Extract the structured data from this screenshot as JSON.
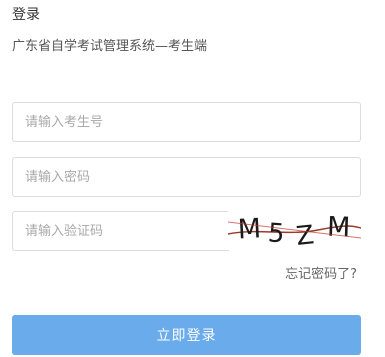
{
  "header": {
    "title": "登录",
    "subtitle": "广东省自学考试管理系统—考生端"
  },
  "form": {
    "username_placeholder": "请输入考生号",
    "password_placeholder": "请输入密码",
    "captcha_placeholder": "请输入验证码",
    "captcha_text": "M5ZM",
    "captcha_chars": [
      "M",
      "5",
      "Z",
      "M"
    ],
    "forgot_label": "忘记密码了?",
    "login_label": "立即登录"
  },
  "colors": {
    "primary_button": "#6aabeb",
    "input_border": "#dcdcdc",
    "captcha_noise": "#c0392b"
  }
}
